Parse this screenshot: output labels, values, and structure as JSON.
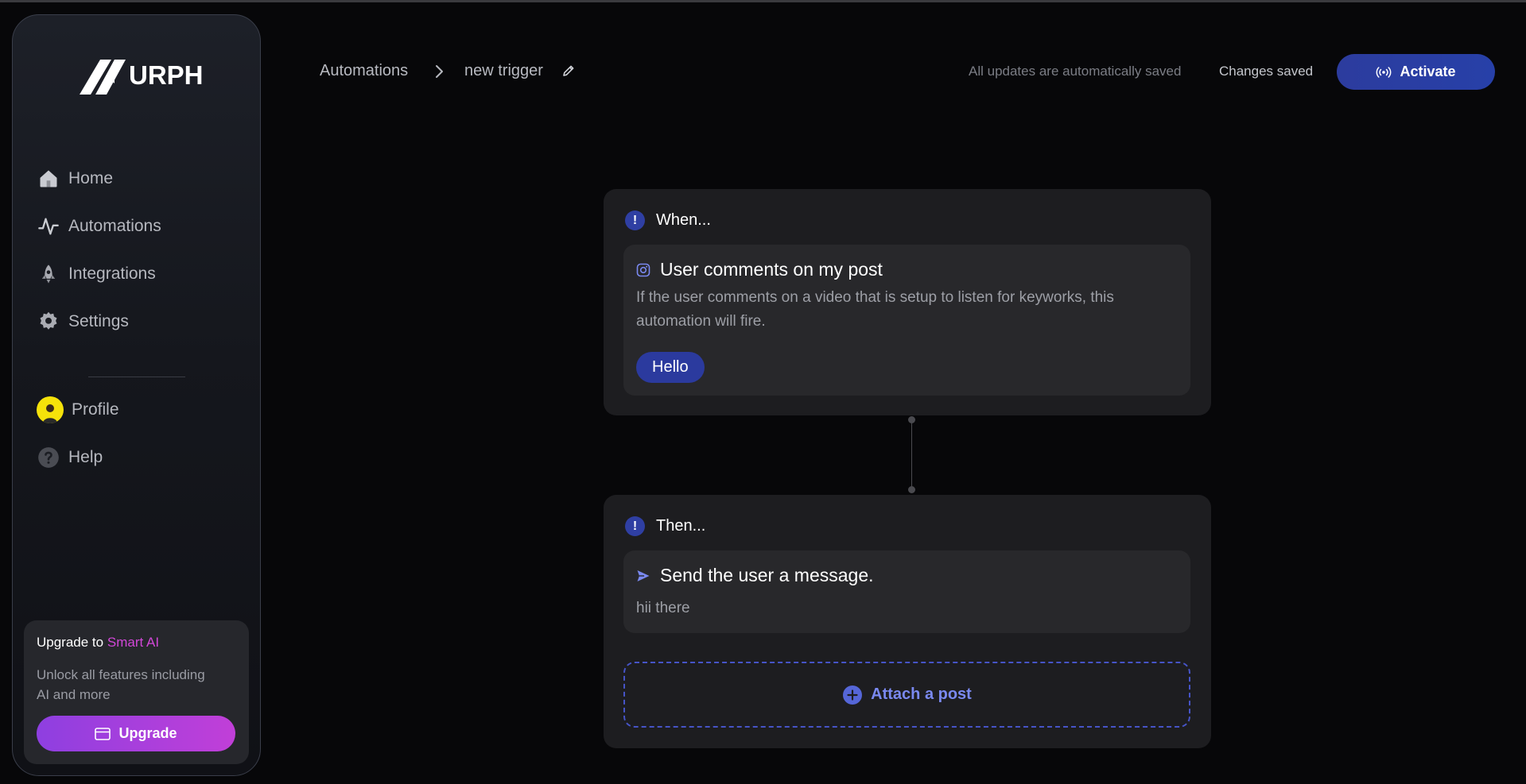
{
  "brand": {
    "logo_text": "URPH"
  },
  "sidebar": {
    "items": [
      {
        "label": "Home",
        "icon": "home-icon"
      },
      {
        "label": "Automations",
        "icon": "activity-icon"
      },
      {
        "label": "Integrations",
        "icon": "rocket-icon"
      },
      {
        "label": "Settings",
        "icon": "gear-icon"
      }
    ],
    "secondary": [
      {
        "label": "Profile",
        "icon": "avatar"
      },
      {
        "label": "Help",
        "icon": "help-icon"
      }
    ],
    "upgrade": {
      "title_prefix": "Upgrade to",
      "title_accent": "Smart AI",
      "description": "Unlock all features including AI and more",
      "button_label": "Upgrade"
    }
  },
  "header": {
    "breadcrumb": [
      "Automations",
      "new trigger"
    ],
    "autosave_note": "All updates are automatically saved",
    "status": "Changes saved",
    "activate_label": "Activate"
  },
  "trigger_card": {
    "heading": "When...",
    "title": "User comments on my post",
    "description": "If the user comments on a video that is setup to listen for keyworks, this automation will fire.",
    "keyword": "Hello"
  },
  "action_card": {
    "heading": "Then...",
    "title": "Send the user a message.",
    "message": "hii there",
    "attach_label": "Attach a post"
  },
  "colors": {
    "accent_blue": "#2b3a9e",
    "accent_purple": "#c13fd8",
    "background": "#070709"
  }
}
